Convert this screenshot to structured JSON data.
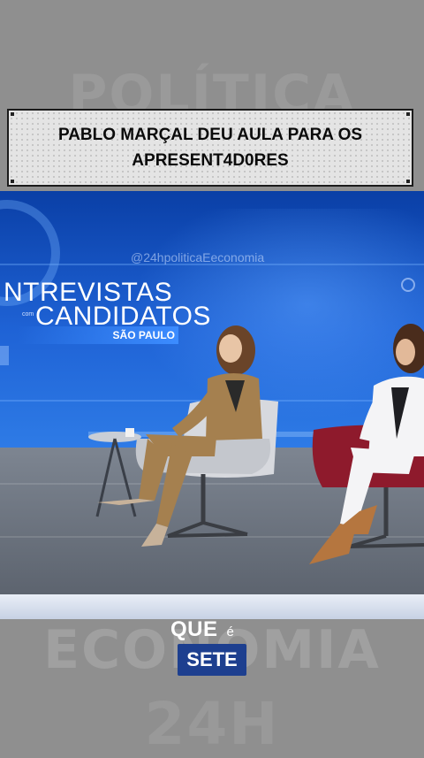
{
  "background_words": {
    "top": "POLÍTICA",
    "middle": "ECONOMIA",
    "bottom": "24H"
  },
  "caption": {
    "line1": "PABLO MARÇAL DEU AULA PARA OS",
    "line2": "APRESENT4D0RES"
  },
  "video": {
    "watermark": "@24hpoliticaEeconomia",
    "show_title_line1": "NTREVISTAS",
    "show_title_small": "com",
    "show_title_line2": "CANDIDATOS",
    "show_subtitle": "SÃO PAULO"
  },
  "brand": {
    "line1": "QUE",
    "connector": "é",
    "badge": "SETE"
  },
  "colors": {
    "page_background": "#8f8f8f",
    "studio_blue": "#1f63d6",
    "badge_blue": "#1d3f8f",
    "chair_red": "#8e1a2c",
    "blazer_tan": "#a5804f"
  }
}
